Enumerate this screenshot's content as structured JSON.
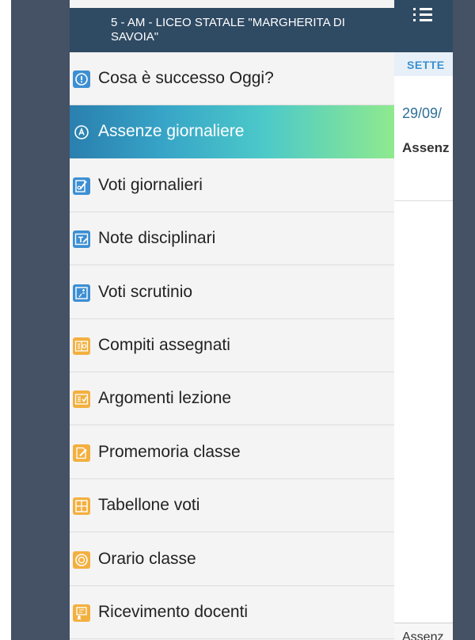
{
  "app": {
    "school_title": "5 - AM - LICEO STATALE \"MARGHERITA DI SAVOIA\"",
    "tab_label": "SETTE",
    "date_label": "29/09/",
    "entry_label": "Assenz",
    "bottom_label": "Assenz"
  },
  "menu": {
    "items": [
      {
        "label": "Cosa è successo Oggi?",
        "icon": "info-icon",
        "color": "blue"
      },
      {
        "label": "Assenze giornaliere",
        "icon": "absence-icon",
        "color": "blue",
        "active": true
      },
      {
        "label": "Voti giornalieri",
        "icon": "grades-icon",
        "color": "blue"
      },
      {
        "label": "Note disciplinari",
        "icon": "notes-icon",
        "color": "blue"
      },
      {
        "label": "Voti scrutinio",
        "icon": "scrutiny-icon",
        "color": "blue"
      },
      {
        "label": "Compiti assegnati",
        "icon": "homework-icon",
        "color": "orange"
      },
      {
        "label": "Argomenti lezione",
        "icon": "lesson-topics-icon",
        "color": "orange"
      },
      {
        "label": "Promemoria classe",
        "icon": "reminder-icon",
        "color": "orange"
      },
      {
        "label": "Tabellone voti",
        "icon": "grades-board-icon",
        "color": "orange"
      },
      {
        "label": "Orario classe",
        "icon": "timetable-icon",
        "color": "orange"
      },
      {
        "label": "Ricevimento docenti",
        "icon": "teacher-meeting-icon",
        "color": "orange"
      }
    ]
  },
  "colors": {
    "header": "#2f4a63",
    "frame": "#455164",
    "accent_blue": "#3d8fd3",
    "accent_orange": "#f3b03f"
  }
}
